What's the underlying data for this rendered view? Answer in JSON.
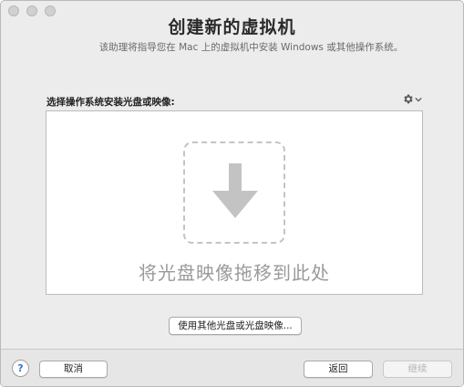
{
  "window": {
    "title": "创建新的虚拟机",
    "subtitle": "该助理将指导您在 Mac 上的虚拟机中安装 Windows 或其他操作系统。"
  },
  "source": {
    "label": "选择操作系统安装光盘或映像:",
    "drop_text": "将光盘映像拖移到此处",
    "other_button": "使用其他光盘或光盘映像..."
  },
  "footer": {
    "help": "?",
    "cancel": "取消",
    "back": "返回",
    "continue": "继续"
  },
  "icons": {
    "settings": "gear-icon",
    "drop": "down-arrow-icon"
  }
}
